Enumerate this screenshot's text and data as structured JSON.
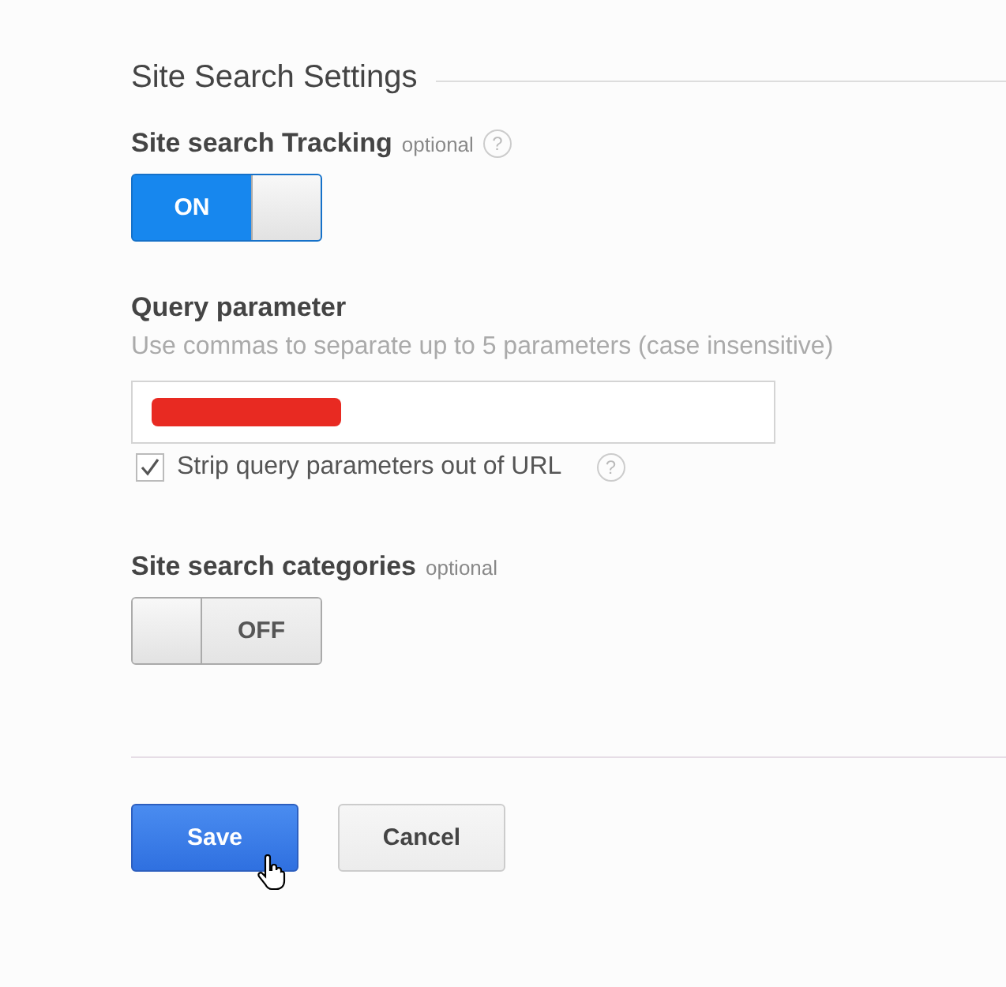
{
  "section_title": "Site Search Settings",
  "tracking": {
    "label": "Site search Tracking",
    "optional": "optional",
    "help": "?",
    "toggle": {
      "on": true,
      "text": "ON"
    }
  },
  "query": {
    "label": "Query parameter",
    "hint": "Use commas to separate up to 5 parameters (case insensitive)",
    "field": {
      "redacted": true
    },
    "strip": {
      "label": "Strip query parameters out of URL",
      "checked": true,
      "help": "?"
    }
  },
  "categories": {
    "label": "Site search categories",
    "optional": "optional",
    "toggle": {
      "on": false,
      "text": "OFF"
    }
  },
  "buttons": [
    {
      "label": "Save",
      "kind": "primary",
      "hovered": true
    },
    {
      "label": "Cancel",
      "kind": "secondary",
      "hovered": false
    }
  ]
}
